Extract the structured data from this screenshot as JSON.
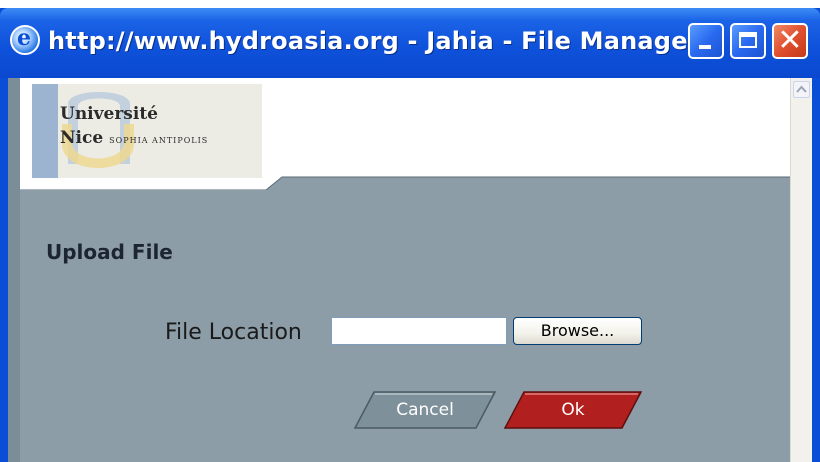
{
  "window": {
    "title": "http://www.hydroasia.org - Jahia - File Manage..."
  },
  "logo": {
    "line1": "Université",
    "line2": "Nice",
    "line2_sub": "SOPHIA ANTIPOLIS"
  },
  "form": {
    "heading": "Upload File",
    "file_location_label": "File Location",
    "file_location_value": "",
    "browse_label": "Browse...",
    "cancel_label": "Cancel",
    "ok_label": "Ok"
  },
  "colors": {
    "titlebar": "#0a4ed8",
    "panel": "#8d9da7",
    "cancel_button": "#7d8f98",
    "ok_button": "#b3201f"
  },
  "icons": [
    "ie-page-icon",
    "minimize-icon",
    "maximize-icon",
    "close-icon",
    "scroll-up-icon"
  ]
}
